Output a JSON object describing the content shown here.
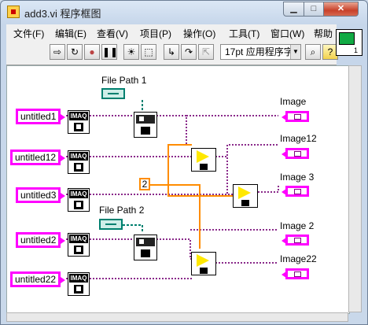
{
  "window": {
    "title": "add3.vi 程序框图"
  },
  "menu": [
    "文件(F)",
    "编辑(E)",
    "查看(V)",
    "项目(P)",
    "操作(O)",
    "工具(T)",
    "窗口(W)",
    "帮助"
  ],
  "toolbar": {
    "font_label": "17pt 应用程序字",
    "help_label": "?"
  },
  "vi_icon": {
    "number": "1"
  },
  "diagram": {
    "controls": [
      "untitled1",
      "untitled12",
      "untitled3",
      "untitled2",
      "untitled22"
    ],
    "imaq_label": "IMAQ",
    "file_paths": [
      "File Path 1",
      "File Path 2"
    ],
    "constant": "2",
    "indicators": [
      "Image",
      "Image12",
      "Image 3",
      "Image 2",
      "Image22"
    ]
  }
}
